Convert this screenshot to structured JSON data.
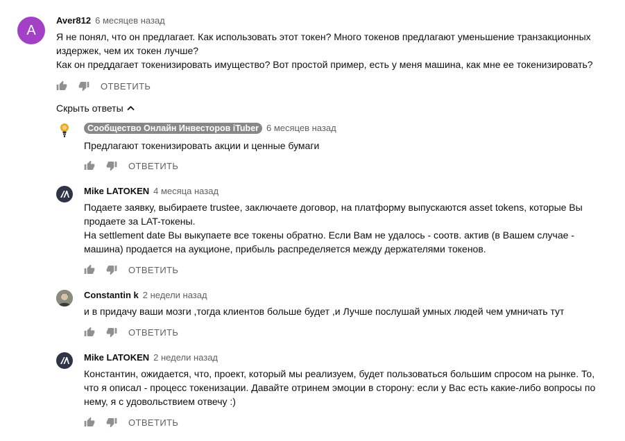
{
  "top_comment": {
    "avatar_letter": "A",
    "avatar_color": "#a341c6",
    "author": "Aver812",
    "time": "6 месяцев назад",
    "text": "Я не понял, что он предлагает. Как использовать этот токен? Много токенов предлагают уменьшение транзакционных\nиздержек, чем их токен лучше?\nКак он преддагает токенизировать имущество? Вот простой пример, есть у меня машина, как мне ее токенизировать?",
    "reply_label": "ОТВЕТИТЬ"
  },
  "hide_replies_label": "Скрыть ответы",
  "replies": [
    {
      "author": "Сообщество Онлайн Инвесторов iTuber",
      "time": "6 месяцев назад",
      "text": "Предлагают токенизировать акции и ценные бумаги",
      "reply_label": "ОТВЕТИТЬ",
      "avatar_icon": "bulb-coin-icon"
    },
    {
      "author": "Mike LATOKEN",
      "time": "4 месяца назад",
      "text": "Подаете заявку, выбираете trustee, заключаете договор, на платформу выпускаются asset tokens, которые Вы\nпродаете за LAT-токены.\nНа settlement date Вы выкупаете все токены обратно. Если Вам не удалось - соотв. актив (в Вашем случае -\nмашина) продается на аукционе, прибыль распределяется между держателями токенов.",
      "reply_label": "ОТВЕТИТЬ",
      "avatar_icon": "latoken-logo-icon"
    },
    {
      "author": "Constantin k",
      "time": "2 недели назад",
      "text": "и в придачу ваши мозги ,тогда клиентов больше будет ,и Лучше послушай умных людей чем умничать тут",
      "reply_label": "ОТВЕТИТЬ",
      "avatar_icon": "photo-avatar-icon"
    },
    {
      "author": "Mike LATOKEN",
      "time": "2 недели назад",
      "text": "Константин, ожидается, что, проект, который мы реализуем, будет пользоваться большим спросом на рынке. То,\nчто я описал - процесс токенизации. Давайте отринем эмоции в сторону: если у Вас есть какие-либо вопросы по\nнему, я с удовольствием отвечу :)",
      "reply_label": "ОТВЕТИТЬ",
      "avatar_icon": "latoken-logo-icon"
    }
  ]
}
